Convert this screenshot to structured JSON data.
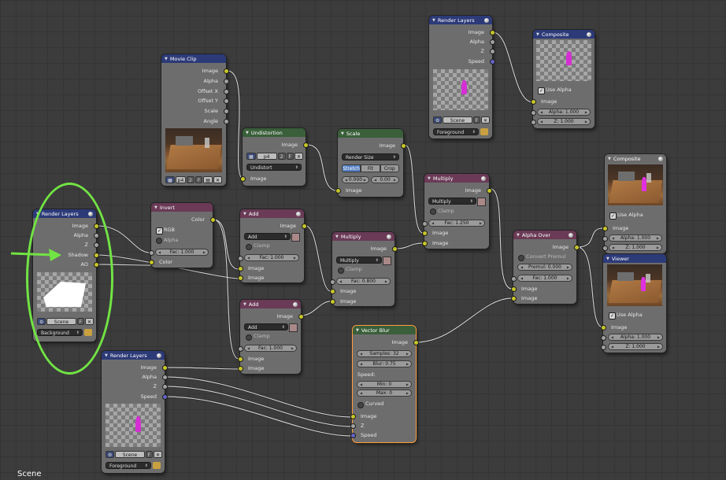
{
  "editor": {
    "scene_label": "Scene"
  },
  "render_layers_1": {
    "title": "Render Layers",
    "outputs": [
      "Image",
      "Alpha",
      "Z",
      "Shadow",
      "AO"
    ],
    "scene": "Scene",
    "layer": "Background"
  },
  "render_layers_2": {
    "title": "Render Layers",
    "outputs": [
      "Image",
      "Alpha",
      "Z",
      "Speed"
    ],
    "scene": "Scene",
    "layer": "Foreground"
  },
  "render_layers_3": {
    "title": "Render Layers",
    "outputs": [
      "Image",
      "Alpha",
      "Z",
      "Speed"
    ],
    "scene": "Scene",
    "layer": "Foreground"
  },
  "movie_clip": {
    "title": "Movie Clip",
    "outputs": [
      "Image",
      "Alpha",
      "Offset X",
      "Offset Y",
      "Scale",
      "Angle"
    ],
    "clip": "p4",
    "users": "2"
  },
  "undistortion": {
    "title": "Undistortion",
    "output": "Image",
    "clip": "p4",
    "users": "2",
    "mode": "Undistort",
    "input": "Image"
  },
  "scale": {
    "title": "Scale",
    "output": "Image",
    "mode": "Render Size",
    "options": [
      "Stretch",
      "Fit",
      "Crop"
    ],
    "active_option": "Stretch",
    "offset_x": "0.000",
    "offset_y": "0.00",
    "input": "Image"
  },
  "invert": {
    "title": "Invert",
    "output": "Color",
    "rgb": "RGB",
    "alpha": "Alpha",
    "fac": "Fac: 1.000",
    "input": "Color"
  },
  "add_1": {
    "title": "Add",
    "output": "Image",
    "mode": "Add",
    "clamp": "Clamp",
    "fac": "Fac: 1.000",
    "inputs": [
      "Image",
      "Image"
    ]
  },
  "add_2": {
    "title": "Add",
    "output": "Image",
    "mode": "Add",
    "clamp": "Clamp",
    "fac": "Fac: 1.000",
    "inputs": [
      "Image",
      "Image"
    ]
  },
  "multiply_1": {
    "title": "Multiply",
    "output": "Image",
    "mode": "Multiply",
    "clamp": "Clamp",
    "fac": "Fac: 0.800",
    "inputs": [
      "Image",
      "Image"
    ]
  },
  "multiply_2": {
    "title": "Multiply",
    "output": "Image",
    "mode": "Multiply",
    "clamp": "Clamp",
    "fac": "Fac: 1.250",
    "inputs": [
      "Image",
      "Image"
    ]
  },
  "alpha_over": {
    "title": "Alpha Over",
    "output": "Image",
    "convert": "Convert Premul",
    "premul": "Premul: 0.000",
    "fac": "Fac: 1.000",
    "inputs": [
      "Image",
      "Image"
    ]
  },
  "vector_blur": {
    "title": "Vector Blur",
    "output": "Image",
    "samples": "Samples: 32",
    "blur": "Blur: 0.75",
    "speed_label": "Speed:",
    "min": "Min: 0",
    "max": "Max: 0",
    "curved": "Curved",
    "inputs": [
      "Image",
      "Z",
      "Speed"
    ]
  },
  "composite_1": {
    "title": "Composite",
    "use_alpha": "Use Alpha",
    "inputs": [
      "Image",
      "Alpha: 1.000",
      "Z: 1.000"
    ]
  },
  "composite_2": {
    "title": "Composite",
    "use_alpha": "Use Alpha",
    "inputs": [
      "Image",
      "Alpha: 1.000",
      "Z: 1.000"
    ]
  },
  "viewer": {
    "title": "Viewer",
    "use_alpha": "Use Alpha",
    "inputs": [
      "Image",
      "Alpha: 1.000",
      "Z: 1.000"
    ]
  },
  "colors": {
    "input_header": "#2c3a78",
    "filter_header": "#3c6e6a",
    "color_header": "#6a3a56",
    "output_header": "#3f6a3c",
    "socket_color": "#c7c729",
    "socket_gray": "#a1a1a1",
    "socket_vector": "#6363c7",
    "annotation": "#72e444"
  }
}
